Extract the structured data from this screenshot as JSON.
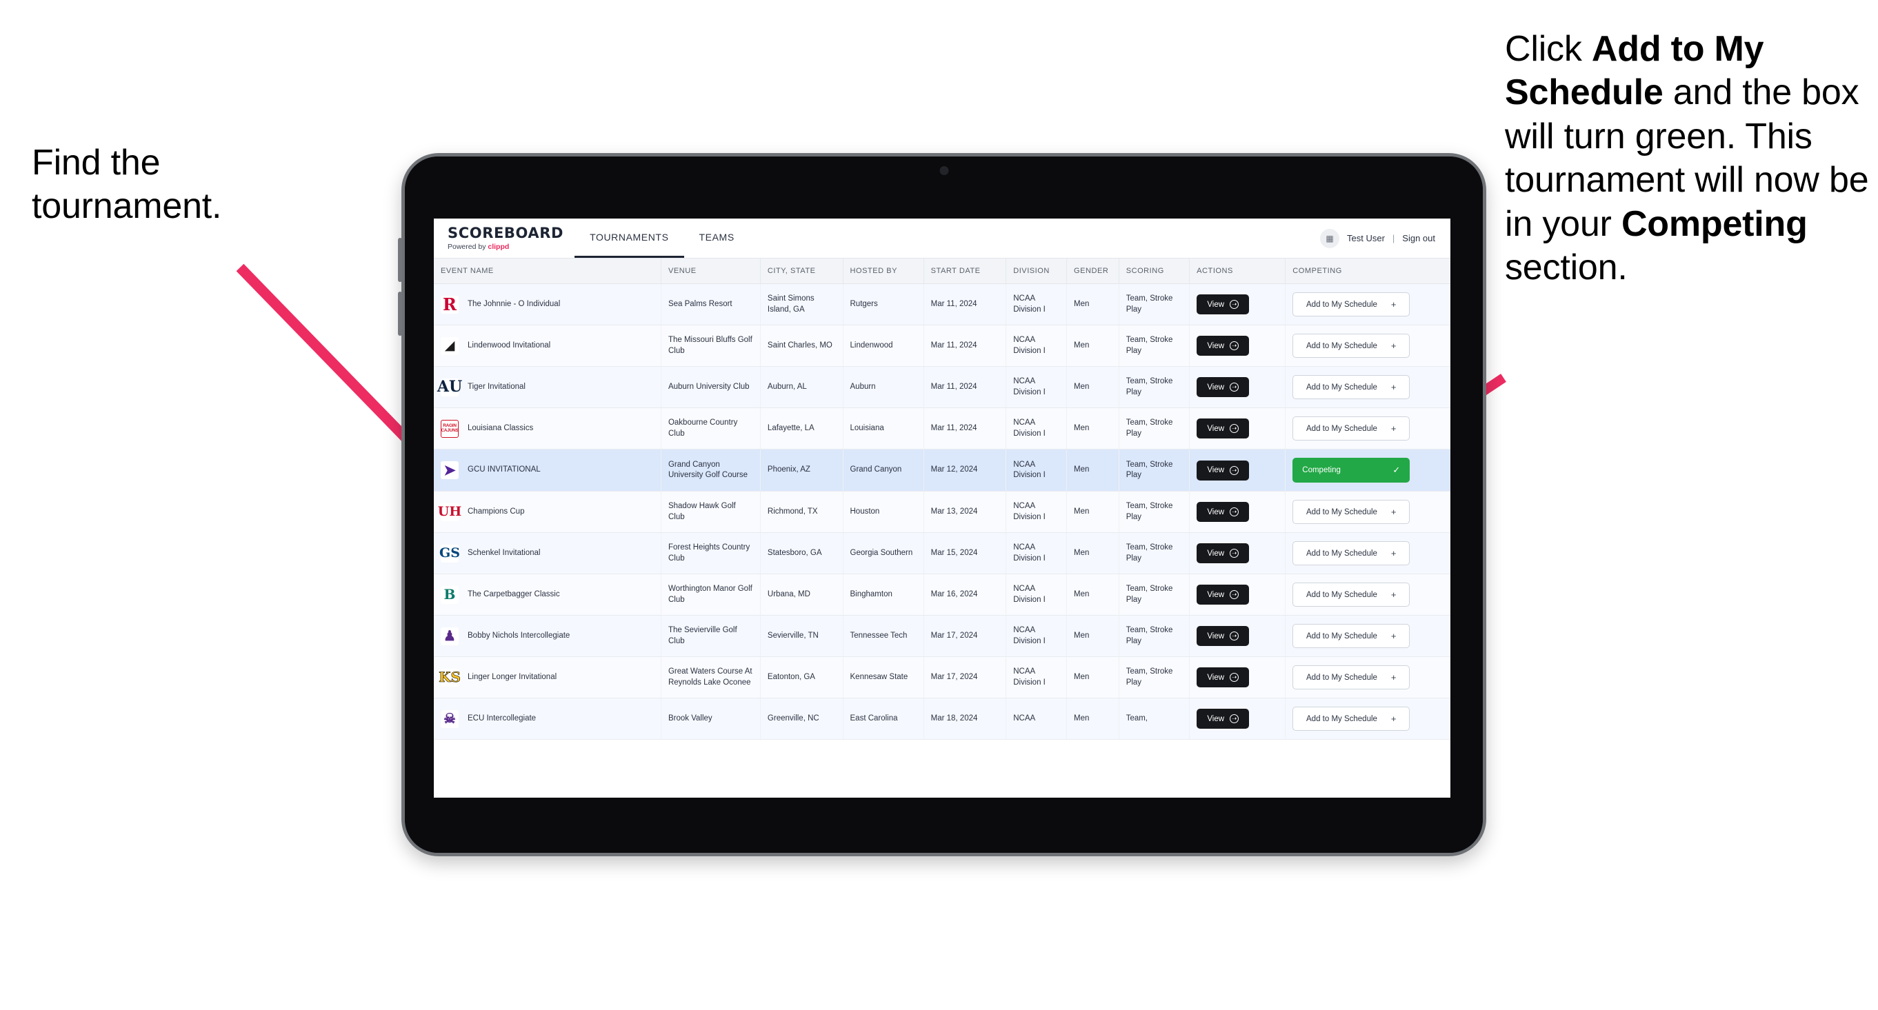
{
  "annotations": {
    "left": {
      "text": "Find the tournament."
    },
    "right": {
      "part1": "Click ",
      "bold1": "Add to My Schedule",
      "part2": " and the box will turn green. This tournament will now be in your ",
      "bold2": "Competing",
      "part3": " section."
    }
  },
  "colors": {
    "arrow": "#ED2C62",
    "accent_pink": "#E8285F",
    "competing_green": "#22A846",
    "dark_button": "#17181C",
    "row_highlight": "#DBE7FB"
  },
  "app": {
    "brand": {
      "title": "SCOREBOARD",
      "powered_prefix": "Powered by ",
      "powered_brand": "clippd"
    },
    "tabs": [
      {
        "label": "TOURNAMENTS",
        "active": true
      },
      {
        "label": "TEAMS",
        "active": false
      }
    ],
    "header_right": {
      "avatar_icon": "user-avatar-icon",
      "user": "Test User",
      "separator": "|",
      "signout": "Sign out"
    },
    "table": {
      "columns": [
        "EVENT NAME",
        "VENUE",
        "CITY, STATE",
        "HOSTED BY",
        "START DATE",
        "DIVISION",
        "GENDER",
        "SCORING",
        "ACTIONS",
        "COMPETING"
      ],
      "view_label": "View",
      "add_label": "Add to My Schedule",
      "add_plus": "+",
      "competing_label": "Competing",
      "competing_check": "✓",
      "rows": [
        {
          "logo": "rutgers-logo",
          "logo_glyph": "R",
          "logo_class": "logo-rutgers",
          "event": "The Johnnie - O Individual",
          "venue": "Sea Palms Resort",
          "city": "Saint Simons Island, GA",
          "host": "Rutgers",
          "date": "Mar 11, 2024",
          "division": "NCAA Division I",
          "gender": "Men",
          "scoring": "Team, Stroke Play",
          "competing": false,
          "highlight": false
        },
        {
          "logo": "lindenwood-logo",
          "logo_glyph": "◢",
          "logo_class": "logo-lindenwood",
          "event": "Lindenwood Invitational",
          "venue": "The Missouri Bluffs Golf Club",
          "city": "Saint Charles, MO",
          "host": "Lindenwood",
          "date": "Mar 11, 2024",
          "division": "NCAA Division I",
          "gender": "Men",
          "scoring": "Team, Stroke Play",
          "competing": false,
          "highlight": false
        },
        {
          "logo": "auburn-logo",
          "logo_glyph": "AU",
          "logo_class": "logo-auburn",
          "event": "Tiger Invitational",
          "venue": "Auburn University Club",
          "city": "Auburn, AL",
          "host": "Auburn",
          "date": "Mar 11, 2024",
          "division": "NCAA Division I",
          "gender": "Men",
          "scoring": "Team, Stroke Play",
          "competing": false,
          "highlight": false
        },
        {
          "logo": "louisiana-ragin-cajuns-logo",
          "logo_glyph": "RAGIN\nCAJUNS",
          "logo_class": "logo-louisiana",
          "event": "Louisiana Classics",
          "venue": "Oakbourne Country Club",
          "city": "Lafayette, LA",
          "host": "Louisiana",
          "date": "Mar 11, 2024",
          "division": "NCAA Division I",
          "gender": "Men",
          "scoring": "Team, Stroke Play",
          "competing": false,
          "highlight": false
        },
        {
          "logo": "grand-canyon-lopes-logo",
          "logo_glyph": "➤",
          "logo_class": "logo-gcu",
          "event": "GCU INVITATIONAL",
          "venue": "Grand Canyon University Golf Course",
          "city": "Phoenix, AZ",
          "host": "Grand Canyon",
          "date": "Mar 12, 2024",
          "division": "NCAA Division I",
          "gender": "Men",
          "scoring": "Team, Stroke Play",
          "competing": true,
          "highlight": true
        },
        {
          "logo": "houston-cougars-logo",
          "logo_glyph": "UH",
          "logo_class": "logo-houston",
          "event": "Champions Cup",
          "venue": "Shadow Hawk Golf Club",
          "city": "Richmond, TX",
          "host": "Houston",
          "date": "Mar 13, 2024",
          "division": "NCAA Division I",
          "gender": "Men",
          "scoring": "Team, Stroke Play",
          "competing": false,
          "highlight": false
        },
        {
          "logo": "georgia-southern-logo",
          "logo_glyph": "GS",
          "logo_class": "logo-gasouthern",
          "event": "Schenkel Invitational",
          "venue": "Forest Heights Country Club",
          "city": "Statesboro, GA",
          "host": "Georgia Southern",
          "date": "Mar 15, 2024",
          "division": "NCAA Division I",
          "gender": "Men",
          "scoring": "Team, Stroke Play",
          "competing": false,
          "highlight": false
        },
        {
          "logo": "binghamton-bearcats-logo",
          "logo_glyph": "B",
          "logo_class": "logo-binghamton",
          "event": "The Carpetbagger Classic",
          "venue": "Worthington Manor Golf Club",
          "city": "Urbana, MD",
          "host": "Binghamton",
          "date": "Mar 16, 2024",
          "division": "NCAA Division I",
          "gender": "Men",
          "scoring": "Team, Stroke Play",
          "competing": false,
          "highlight": false
        },
        {
          "logo": "tennessee-tech-logo",
          "logo_glyph": "♟",
          "logo_class": "logo-ttech",
          "event": "Bobby Nichols Intercollegiate",
          "venue": "The Sevierville Golf Club",
          "city": "Sevierville, TN",
          "host": "Tennessee Tech",
          "date": "Mar 17, 2024",
          "division": "NCAA Division I",
          "gender": "Men",
          "scoring": "Team, Stroke Play",
          "competing": false,
          "highlight": false
        },
        {
          "logo": "kennesaw-state-owls-logo",
          "logo_glyph": "KS",
          "logo_class": "logo-kennesaw",
          "event": "Linger Longer Invitational",
          "venue": "Great Waters Course At Reynolds Lake Oconee",
          "city": "Eatonton, GA",
          "host": "Kennesaw State",
          "date": "Mar 17, 2024",
          "division": "NCAA Division I",
          "gender": "Men",
          "scoring": "Team, Stroke Play",
          "competing": false,
          "highlight": false
        },
        {
          "logo": "east-carolina-pirates-logo",
          "logo_glyph": "☠",
          "logo_class": "logo-ecu",
          "event": "ECU Intercollegiate",
          "venue": "Brook Valley",
          "city": "Greenville, NC",
          "host": "East Carolina",
          "date": "Mar 18, 2024",
          "division": "NCAA",
          "gender": "Men",
          "scoring": "Team,",
          "competing": false,
          "highlight": false
        }
      ]
    }
  }
}
